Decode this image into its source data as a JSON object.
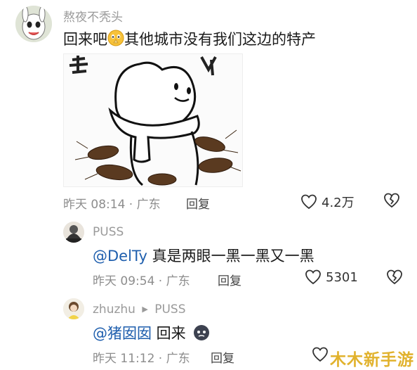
{
  "comment1": {
    "username": "熬夜不秃头",
    "text_before": "回来吧",
    "text_after": "其他城市没有我们这边的特产",
    "time": "昨天 08:14 · 广东",
    "reply_label": "回复",
    "likes": "4.2万"
  },
  "comment2": {
    "username": "PUSS",
    "mention": "@DelTy",
    "text": " 真是两眼一黑一黑又一黑",
    "time": "昨天 09:54 · 广东",
    "reply_label": "回复",
    "likes": "5301"
  },
  "comment3": {
    "username": "zhuzhu",
    "reply_to": "PUSS",
    "mention": "@猪囡囡",
    "text": " 回来",
    "time": "昨天 11:12 · 广东",
    "reply_label": "回复"
  },
  "watermark": "木木新手游"
}
